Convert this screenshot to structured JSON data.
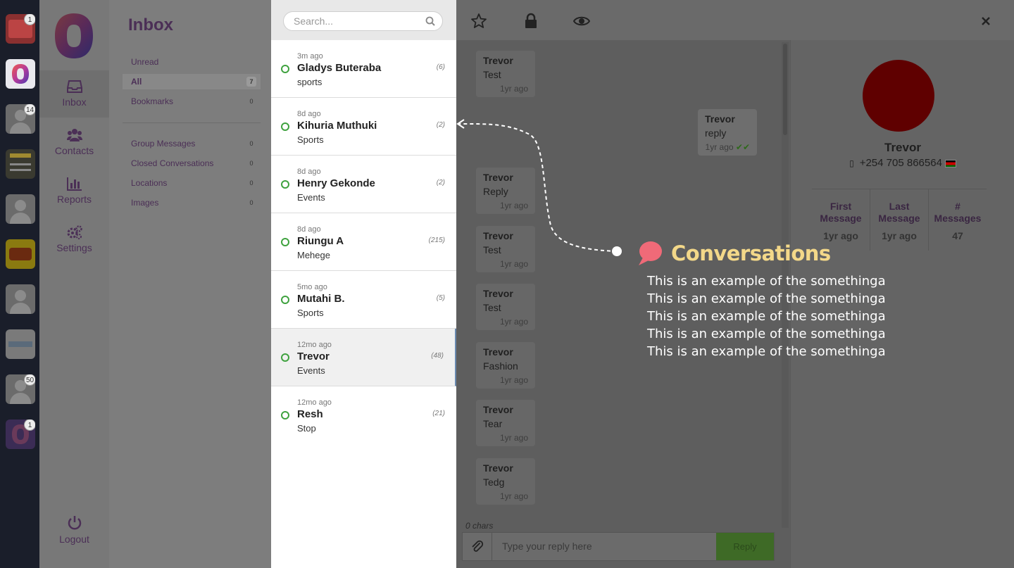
{
  "workspaces": [
    {
      "badge": "1",
      "kind": "brand-red"
    },
    {
      "badge": "",
      "kind": "app-logo",
      "selected": true
    },
    {
      "badge": "14",
      "kind": "person"
    },
    {
      "badge": "",
      "kind": "brand-dark"
    },
    {
      "badge": "",
      "kind": "person"
    },
    {
      "badge": "",
      "kind": "brand-yellow"
    },
    {
      "badge": "",
      "kind": "person"
    },
    {
      "badge": "",
      "kind": "brand-text"
    },
    {
      "badge": "50",
      "kind": "person"
    },
    {
      "badge": "1",
      "kind": "app-logo"
    }
  ],
  "nav": {
    "inbox": "Inbox",
    "contacts": "Contacts",
    "reports": "Reports",
    "settings": "Settings",
    "logout": "Logout"
  },
  "folders": {
    "title": "Inbox",
    "items": [
      {
        "label": "Unread",
        "count": ""
      },
      {
        "label": "All",
        "count": "7"
      },
      {
        "label": "Bookmarks",
        "count": "0"
      }
    ],
    "groups": [
      {
        "label": "Group Messages",
        "count": "0"
      },
      {
        "label": "Closed Conversations",
        "count": "0"
      },
      {
        "label": "Locations",
        "count": "0"
      },
      {
        "label": "Images",
        "count": "0"
      }
    ]
  },
  "search": {
    "placeholder": "Search..."
  },
  "conversations": [
    {
      "time": "3m ago",
      "name": "Gladys Buteraba",
      "tag": "sports",
      "count": "(6)"
    },
    {
      "time": "8d ago",
      "name": "Kihuria Muthuki",
      "tag": "Sports",
      "count": "(2)"
    },
    {
      "time": "8d ago",
      "name": "Henry Gekonde",
      "tag": "Events",
      "count": "(2)"
    },
    {
      "time": "8d ago",
      "name": "Riungu A",
      "tag": "Mehege",
      "count": "(215)"
    },
    {
      "time": "5mo ago",
      "name": "Mutahi B.",
      "tag": "Sports",
      "count": "(5)"
    },
    {
      "time": "12mo ago",
      "name": "Trevor",
      "tag": "Events",
      "count": "(48)"
    },
    {
      "time": "12mo ago",
      "name": "Resh",
      "tag": "Stop",
      "count": "(21)"
    }
  ],
  "messages": [
    {
      "who": "Trevor",
      "text": "Test",
      "when": "1yr ago",
      "dir": "in"
    },
    {
      "who": "Trevor",
      "text": "reply",
      "when": "1yr ago",
      "dir": "out"
    },
    {
      "who": "Trevor",
      "text": "Reply",
      "when": "1yr ago",
      "dir": "in"
    },
    {
      "who": "Trevor",
      "text": "Test",
      "when": "1yr ago",
      "dir": "in"
    },
    {
      "who": "Trevor",
      "text": "Test",
      "when": "1yr ago",
      "dir": "in"
    },
    {
      "who": "Trevor",
      "text": "Fashion",
      "when": "1yr ago",
      "dir": "in"
    },
    {
      "who": "Trevor",
      "text": "Tear",
      "when": "1yr ago",
      "dir": "in"
    },
    {
      "who": "Trevor",
      "text": "Tedg",
      "when": "1yr ago",
      "dir": "in"
    }
  ],
  "composer": {
    "chars": "0 chars",
    "placeholder": "Type your reply here",
    "reply_label": "Reply"
  },
  "profile": {
    "name": "Trevor",
    "phone": "+254 705 866564",
    "stats": [
      {
        "label1": "First",
        "label2": "Message",
        "value": "1yr ago"
      },
      {
        "label1": "Last",
        "label2": "Message",
        "value": "1yr ago"
      },
      {
        "label1": "#",
        "label2": "Messages",
        "value": "47"
      }
    ]
  },
  "tour": {
    "title": "Conversations",
    "body": "This is an example of the somethinga This is an example of the somethinga This is an example of the somethinga This is an exam­ple of the somethinga This is an example of the somethinga"
  },
  "colors": {
    "brand_purple": "#4b2f56",
    "online_green": "#3fa23f",
    "tour_title": "#f3d889",
    "tour_bubble": "#f06a78",
    "reply_green": "#3e6a26"
  }
}
